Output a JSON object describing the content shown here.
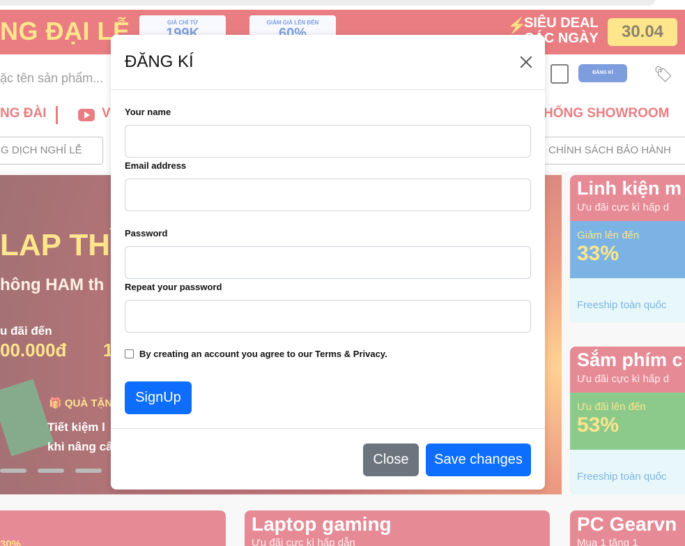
{
  "background": {
    "banner": {
      "headline": "NG ĐẠI LỄ",
      "tag1_small": "GIÁ CHỈ TỪ",
      "tag1_big": "199K",
      "tag2_small": "GIẢM GIÁ LÊN ĐẾN",
      "tag2_big": "60%",
      "deal_line1": "SIÊU DEAL",
      "deal_line2": "CÁC NGÀY",
      "date": "30.04"
    },
    "header": {
      "search_placeholder": "ặc tên sản phẩm...",
      "register_button": "ĐĂNG KÍ"
    },
    "nav": {
      "item_left": "NG ĐÀI",
      "item_video": "V",
      "item_right": "HỐNG SHOWROOM"
    },
    "subnav": {
      "chip_left": "G DỊCH NGHỈ LỄ",
      "chip_right": "CHÍNH SÁCH BẢO HÀNH"
    },
    "hero": {
      "line1": "LAP THÌ",
      "line2": "hông HAM th",
      "line3": "u đãi đến",
      "line4": "00.000đ",
      "line4b": "1",
      "gift": "QUÀ TẶN",
      "save_line1": "Tiết kiệm l",
      "save_line2": "khi nâng cấ"
    },
    "cards": [
      {
        "title": "Linh kiện m",
        "subtitle": "Ưu đãi cực kì hấp d",
        "promo_label": "Giảm lên đến",
        "promo_value": "33%",
        "footer": "Freeship toàn quốc"
      },
      {
        "title": "Sắm phím c",
        "subtitle": "Ưu đãi cực kì hấp d",
        "promo_label": "Ưu đãi lên đến",
        "promo_value": "53%",
        "footer": "Freeship toàn quốc"
      }
    ],
    "bottom_cards": [
      {
        "title": "30%"
      },
      {
        "title": "Laptop gaming",
        "subtitle": "Ưu đãi cực kì hấp dẫn"
      },
      {
        "title": "PC Gearvn",
        "subtitle": "Mua 1 tặng 1"
      }
    ]
  },
  "modal": {
    "title": "ĐĂNG KÍ",
    "fields": [
      {
        "label": "Your name",
        "value": "",
        "placeholder": ""
      },
      {
        "label": "Email address",
        "value": "",
        "placeholder": ""
      },
      {
        "label": "Password",
        "value": "",
        "placeholder": ""
      },
      {
        "label": "Repeat your password",
        "value": "",
        "placeholder": ""
      }
    ],
    "agree_text": "By creating an account you agree to our Terms & Privacy.",
    "agree_checked": false,
    "signup_button": "SignUp",
    "close_button": "Close",
    "save_button": "Save changes"
  },
  "colors": {
    "primary": "#0d6efd",
    "secondary": "#6c757d",
    "brand_red": "#d91f26",
    "accent_yellow": "#ffd33a"
  },
  "icons": [
    "close-icon",
    "checkbox-icon",
    "note-icon",
    "tag-icon",
    "youtube-icon",
    "bolt-icon",
    "gift-icon"
  ]
}
